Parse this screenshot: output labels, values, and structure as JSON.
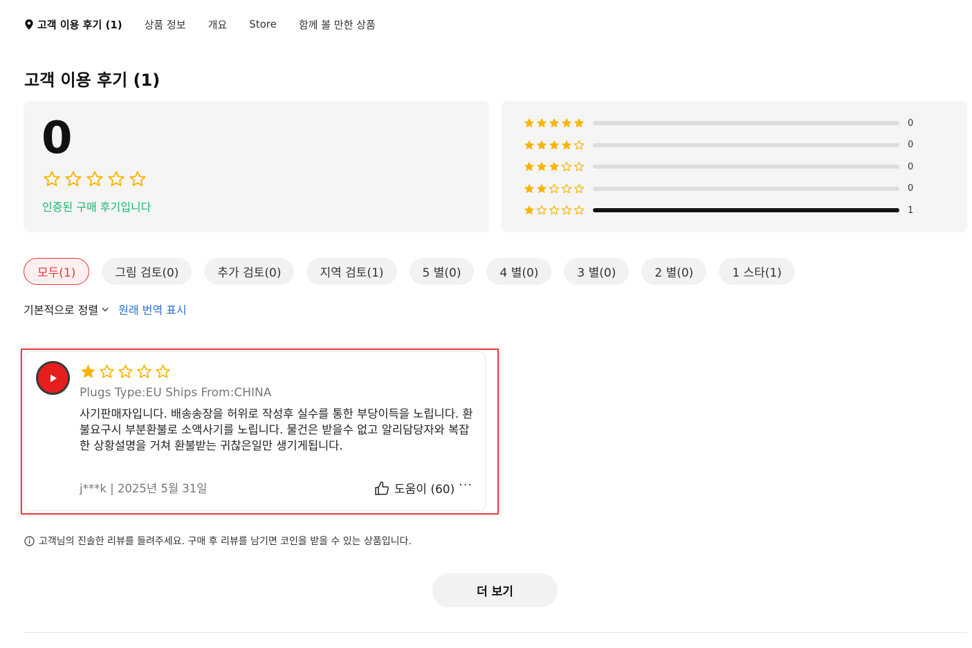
{
  "nav": {
    "items": [
      "고객 이용 후기 (1)",
      "상품 정보",
      "개요",
      "Store",
      "함께 볼 만한 상품"
    ],
    "active_index": 0
  },
  "section": {
    "title": "고객 이용 후기 (1)"
  },
  "summary": {
    "average": "0",
    "average_stars": 0,
    "verified_text": "인증된 구매 후기입니다"
  },
  "distribution": [
    {
      "stars": 5,
      "count": "0",
      "fraction": 0
    },
    {
      "stars": 4,
      "count": "0",
      "fraction": 0
    },
    {
      "stars": 3,
      "count": "0",
      "fraction": 0
    },
    {
      "stars": 2,
      "count": "0",
      "fraction": 0
    },
    {
      "stars": 1,
      "count": "1",
      "fraction": 1
    }
  ],
  "filters": [
    "모두(1)",
    "그림 검토(0)",
    "추가 검토(0)",
    "지역 검토(1)",
    "5 별(0)",
    "4 별(0)",
    "3 별(0)",
    "2 별(0)",
    "1 스타(1)"
  ],
  "filters_active_index": 0,
  "sort": {
    "label": "기본적으로 정렬",
    "translate_label": "원래 번역 표시"
  },
  "review": {
    "rating": 1,
    "variant": "Plugs Type:EU Ships From:CHINA",
    "text": "사기판매자입니다. 배송송장을 허위로 작성후 실수를 통한 부당이득을 노립니다. 환불요구시 부분환불로 소액사기를 노립니다. 물건은 받을수 없고 알리담당자와 복잡한 상황설명을 거쳐 환불받는 귀찮은일만 생기게됩니다.",
    "author_date": "j***k | 2025년 5월 31일",
    "helpful_label": "도움이 (60)",
    "more": "···"
  },
  "notice": "고객님의 진솔한 리뷰를 들려주세요. 구매 후 리뷰를 남기면 코인을 받을 수 있는 상품입니다.",
  "more_button": "더 보기",
  "colors": {
    "star": "#f8b500",
    "verified": "#19b56d",
    "accent_red": "#e9353c",
    "link_blue": "#2a6dd1"
  }
}
